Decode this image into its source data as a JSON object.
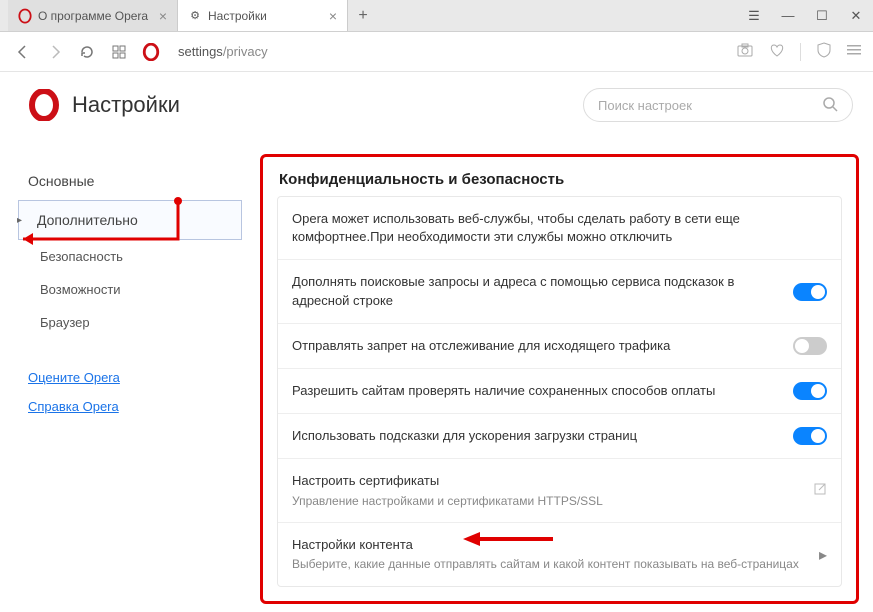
{
  "tabs": [
    {
      "icon": "opera",
      "label": "О программе Opera",
      "active": false
    },
    {
      "icon": "gear",
      "label": "Настройки",
      "active": true
    }
  ],
  "address": {
    "path": "settings",
    "sub": "/privacy"
  },
  "page": {
    "title": "Настройки"
  },
  "search": {
    "placeholder": "Поиск настроек"
  },
  "sidebar": {
    "items": [
      {
        "label": "Основные",
        "type": "item"
      },
      {
        "label": "Дополнительно",
        "type": "item",
        "active": true,
        "caret": "▸"
      },
      {
        "label": "Безопасность",
        "type": "sub"
      },
      {
        "label": "Возможности",
        "type": "sub"
      },
      {
        "label": "Браузер",
        "type": "sub"
      }
    ],
    "links": [
      {
        "label": "Оцените Opera"
      },
      {
        "label": "Справка Opera"
      }
    ]
  },
  "panel": {
    "title": "Конфиденциальность и безопасность",
    "rows": [
      {
        "title": "Opera может использовать веб-службы, чтобы сделать работу в сети еще комфортнее.При необходимости эти службы можно отключить",
        "control": "none"
      },
      {
        "title": "Дополнять поисковые запросы и адреса с помощью сервиса подсказок в адресной строке",
        "control": "toggle",
        "on": true
      },
      {
        "title": "Отправлять запрет на отслеживание для исходящего трафика",
        "control": "toggle",
        "on": false
      },
      {
        "title": "Разрешить сайтам проверять наличие сохраненных способов оплаты",
        "control": "toggle",
        "on": true
      },
      {
        "title": "Использовать подсказки для ускорения загрузки страниц",
        "control": "toggle",
        "on": true
      },
      {
        "title": "Настроить сертификаты",
        "sub": "Управление настройками и сертификатами HTTPS/SSL",
        "control": "external"
      },
      {
        "title": "Настройки контента",
        "sub": "Выберите, какие данные отправлять сайтам и какой контент показывать на веб-страницах",
        "control": "chevron"
      }
    ]
  }
}
